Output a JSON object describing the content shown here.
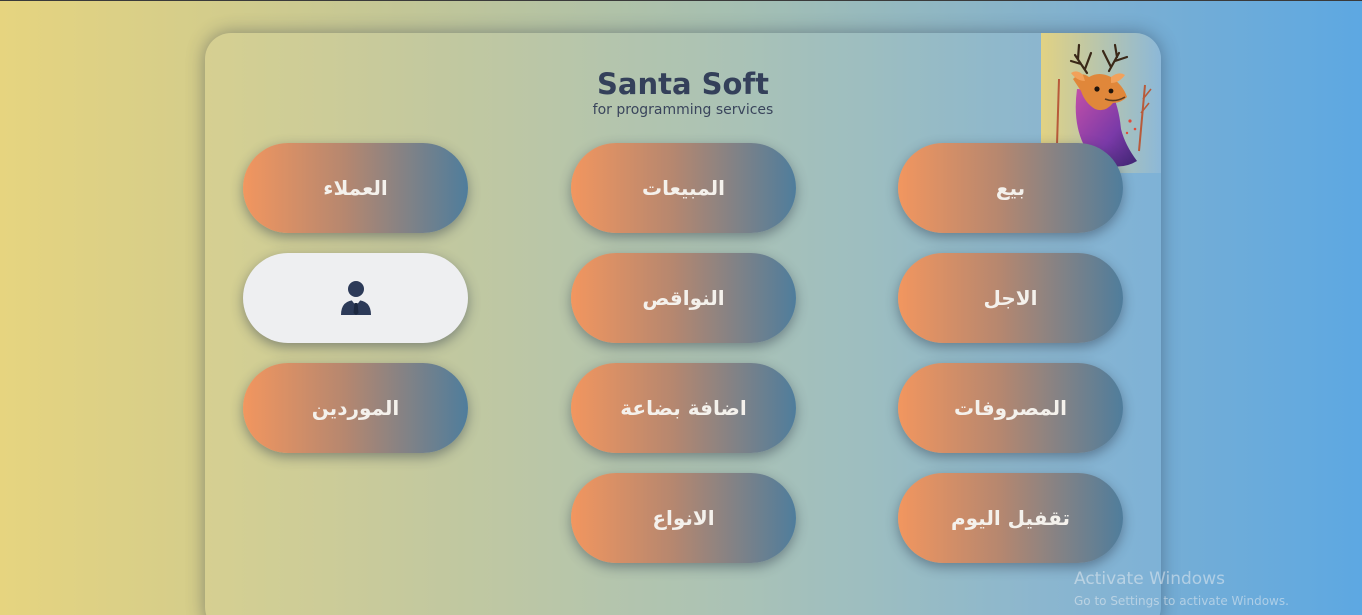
{
  "header": {
    "title": "Santa Soft",
    "subtitle": "for programming services"
  },
  "buttons": {
    "customers": "العملاء",
    "sales": "المبيعات",
    "sell": "بيع",
    "user_icon": "user-suit-icon",
    "shortages": "النواقص",
    "credit": "الاجل",
    "suppliers": "الموردين",
    "add_goods": "اضافة بضاعة",
    "expenses": "المصروفات",
    "types": "الانواع",
    "close_day": "تقفيل اليوم"
  },
  "watermark": {
    "title": "Activate Windows",
    "subtitle": "Go to Settings to activate Windows."
  },
  "colors": {
    "button_start": "#f2965f",
    "button_end": "#4f7d9c",
    "title": "#34405a",
    "icon": "#2c3a58"
  }
}
